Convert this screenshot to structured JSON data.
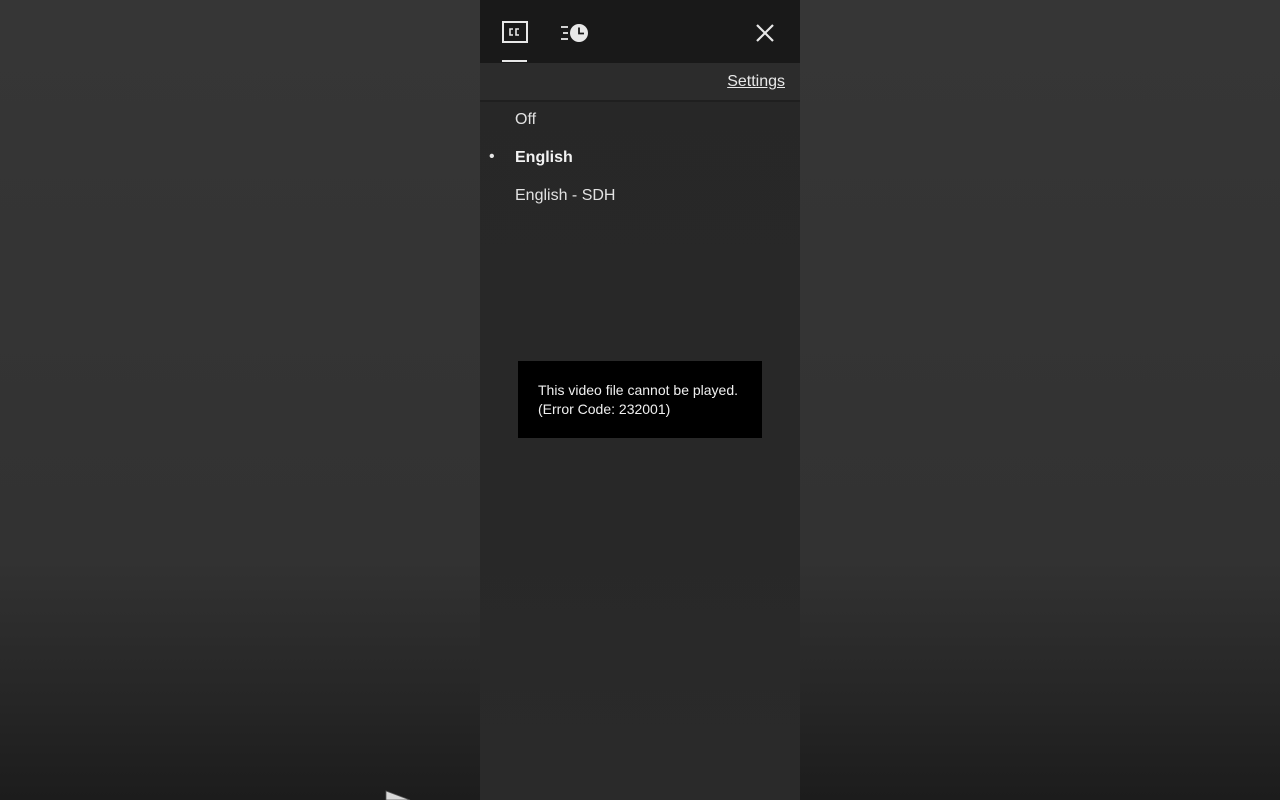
{
  "panel": {
    "tabs": [
      {
        "icon": "closed-captions-icon",
        "active": true
      },
      {
        "icon": "playback-speed-icon",
        "active": false
      }
    ],
    "close_icon": "close-icon",
    "settings_label": "Settings"
  },
  "subtitles": {
    "options": [
      {
        "label": "Off",
        "selected": false
      },
      {
        "label": "English",
        "selected": true
      },
      {
        "label": "English - SDH",
        "selected": false
      }
    ],
    "selected_marker": "•"
  },
  "error": {
    "line1": "This video file cannot be played.",
    "line2": "(Error Code: 232001)"
  },
  "colors": {
    "background": "#333333",
    "panel": "#282828",
    "tabbar": "#191919",
    "text": "#e6e6e6",
    "error_bg": "#000000"
  }
}
